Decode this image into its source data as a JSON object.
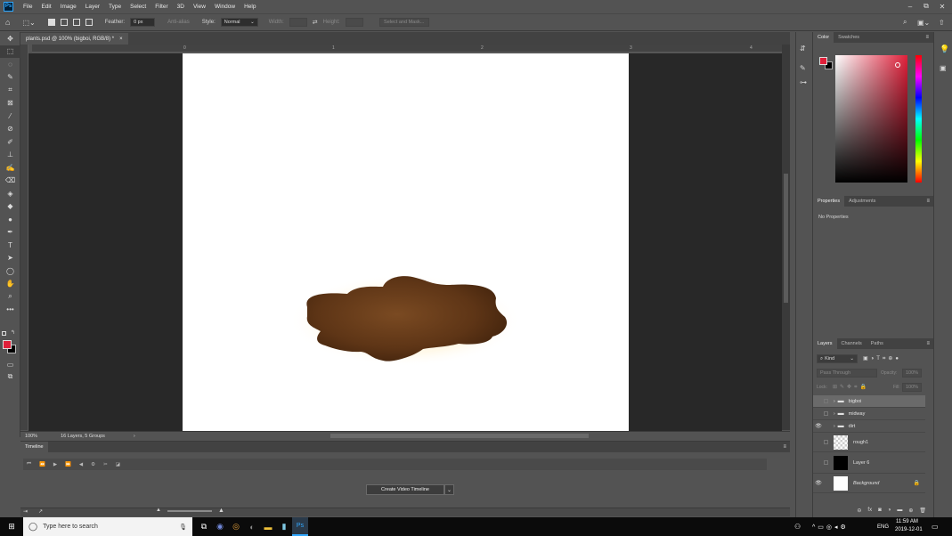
{
  "app": {
    "logo": "Ps"
  },
  "menu": [
    "File",
    "Edit",
    "Image",
    "Layer",
    "Type",
    "Select",
    "Filter",
    "3D",
    "View",
    "Window",
    "Help"
  ],
  "window_controls": {
    "minimize": "–",
    "restore": "⧉",
    "close": "✕"
  },
  "options": {
    "feather_label": "Feather:",
    "feather_value": "0 px",
    "anti_alias": "Anti-alias",
    "style_label": "Style:",
    "style_value": "Normal",
    "width_label": "Width:",
    "height_label": "Height:",
    "select_mask": "Select and Mask..."
  },
  "document": {
    "tab_title": "plants.psd @ 100% (bigboi, RGB/8) *",
    "close": "×"
  },
  "ruler": {
    "labels": [
      "0",
      "1",
      "2",
      "3",
      "4"
    ]
  },
  "status": {
    "zoom": "100%",
    "info": "16 Layers, 5 Groups",
    "arrow": "›"
  },
  "timeline": {
    "title": "Timeline",
    "create_button": "Create Video Timeline"
  },
  "color_panel": {
    "tabs": [
      "Color",
      "Swatches"
    ],
    "fg": "#e0203a",
    "bg": "#000000"
  },
  "properties_panel": {
    "tabs": [
      "Properties",
      "Adjustments"
    ],
    "empty": "No Properties"
  },
  "layers_panel": {
    "tabs": [
      "Layers",
      "Channels",
      "Paths"
    ],
    "kind": "Kind",
    "blend": "Pass Through",
    "opacity_label": "Opacity:",
    "opacity_value": "100%",
    "lock_label": "Lock:",
    "fill_label": "Fill:",
    "fill_value": "100%",
    "layers": [
      {
        "name": "bigboi",
        "type": "group",
        "visible": false,
        "selected": true
      },
      {
        "name": "midway",
        "type": "group",
        "visible": false,
        "selected": false
      },
      {
        "name": "dirt",
        "type": "group",
        "visible": true,
        "selected": false
      },
      {
        "name": "rough1",
        "type": "layer",
        "visible": false,
        "thumb": "checker"
      },
      {
        "name": "Layer 6",
        "type": "layer",
        "visible": false,
        "thumb": "black"
      },
      {
        "name": "Background",
        "type": "layer",
        "visible": true,
        "thumb": "white",
        "locked": true
      }
    ]
  },
  "taskbar": {
    "search_placeholder": "Type here to search",
    "lang": "ENG",
    "time": "11:59 AM",
    "date": "2019-12-01"
  }
}
